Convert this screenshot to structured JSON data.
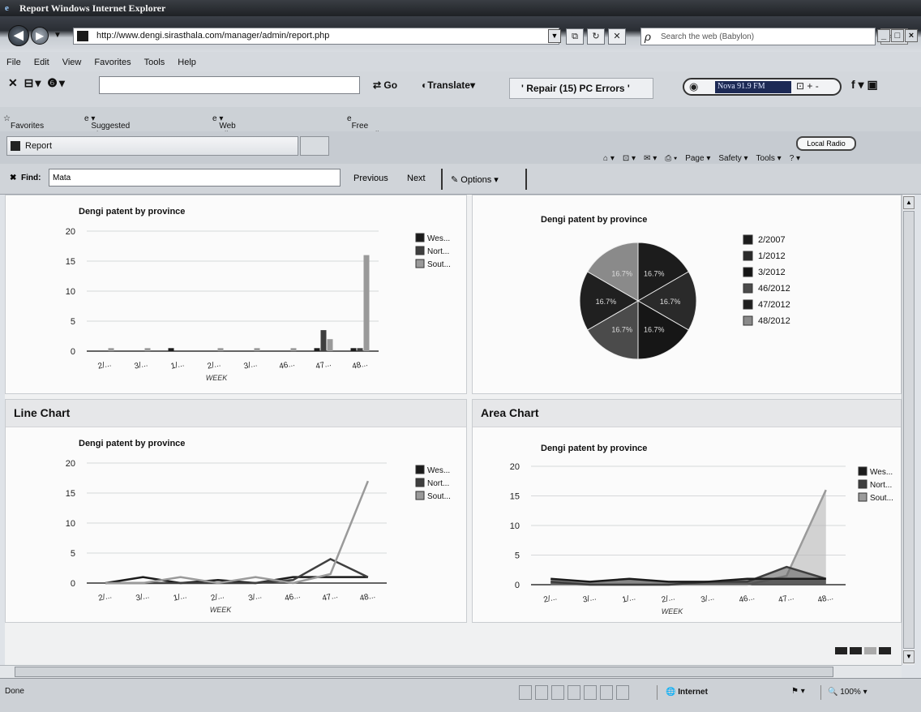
{
  "window": {
    "title": "Report   Windows Internet Explorer",
    "controls": [
      "_",
      "□",
      "×"
    ]
  },
  "address": {
    "url": "http://www.dengi.sirasthala.com/manager/admin/report.php",
    "search_placeholder": "Search the web (Babylon)"
  },
  "menu": [
    "File",
    "Edit",
    "View",
    "Favorites",
    "Tools",
    "Help"
  ],
  "toolbar": {
    "go": "Go",
    "translate": "Translate",
    "repair": "' Repair (15) PC Errors '",
    "radio_station": "Nova 91.9 FM",
    "local_radio": "Local Radio"
  },
  "favorites": {
    "label": "Favorites",
    "items": [
      "Suggested Sites",
      "Web Slice Gallery",
      "Free Hotmail"
    ]
  },
  "tab": {
    "label": "Report"
  },
  "commandbar": [
    "Page",
    "Safety",
    "Tools"
  ],
  "find": {
    "label": "Find:",
    "value": "Mata",
    "previous": "Previous",
    "next": "Next",
    "options": "Options"
  },
  "panels": {
    "line_header": "Line Chart",
    "area_header": "Area Chart"
  },
  "status": {
    "text": "Done",
    "zone": "Internet",
    "zoom": "100%"
  },
  "colors": {
    "west": "#1b1b1b",
    "north": "#3f3f3f",
    "south": "#9a9a9a"
  },
  "chart_data": [
    {
      "type": "bar",
      "title": "Dengi patent by province",
      "xlabel": "WEEK",
      "categories": [
        "2/...",
        "3/...",
        "1/...",
        "2/...",
        "3/...",
        "46...",
        "47...",
        "48..."
      ],
      "series": [
        {
          "name": "Wes...",
          "values": [
            0,
            0,
            0.5,
            0,
            0,
            0,
            0.5,
            0.5
          ]
        },
        {
          "name": "Nort...",
          "values": [
            0,
            0,
            0,
            0,
            0,
            0,
            3.5,
            0.5
          ]
        },
        {
          "name": "Sout...",
          "values": [
            0.5,
            0.5,
            0,
            0.5,
            0.5,
            0.5,
            2,
            16
          ]
        }
      ],
      "ylim": [
        0,
        20
      ],
      "yticks": [
        0,
        5,
        10,
        15,
        20
      ],
      "legend": "right",
      "grid": true
    },
    {
      "type": "pie",
      "title": "Dengi patent by province",
      "labels": [
        "2/2007",
        "1/2012",
        "3/2012",
        "46/2012",
        "47/2012",
        "48/2012"
      ],
      "values": [
        16.7,
        16.7,
        16.7,
        16.7,
        16.7,
        16.7
      ],
      "slice_labels": [
        "16.7%",
        "16.7%",
        "16.7%",
        "16.7%",
        "16.7%",
        "16.7%"
      ],
      "legend": "right"
    },
    {
      "type": "line",
      "title": "Dengi patent by province",
      "xlabel": "WEEK",
      "categories": [
        "2/...",
        "3/...",
        "1/...",
        "2/...",
        "3/...",
        "46...",
        "47...",
        "48..."
      ],
      "series": [
        {
          "name": "Wes...",
          "values": [
            0,
            1,
            0,
            0.5,
            0,
            1,
            1,
            1
          ]
        },
        {
          "name": "Nort...",
          "values": [
            0,
            0,
            0,
            0,
            0,
            0.5,
            4,
            1
          ]
        },
        {
          "name": "Sout...",
          "values": [
            0,
            0,
            1,
            0,
            1,
            0,
            1.5,
            17
          ]
        }
      ],
      "ylim": [
        0,
        20
      ],
      "yticks": [
        0,
        5,
        10,
        15,
        20
      ],
      "legend": "right",
      "grid": true
    },
    {
      "type": "area",
      "title": "Dengi patent by province",
      "xlabel": "WEEK",
      "categories": [
        "2/...",
        "3/...",
        "1/...",
        "2/...",
        "3/...",
        "46...",
        "47...",
        "48..."
      ],
      "series": [
        {
          "name": "Wes...",
          "values": [
            1,
            0.5,
            1,
            0.5,
            0.5,
            1,
            1,
            1
          ]
        },
        {
          "name": "Nort...",
          "values": [
            0.5,
            0,
            0,
            0,
            0.5,
            0.5,
            3,
            1
          ]
        },
        {
          "name": "Sout...",
          "values": [
            0,
            0,
            0,
            0,
            0,
            0,
            1.5,
            16
          ]
        }
      ],
      "ylim": [
        0,
        20
      ],
      "yticks": [
        0,
        5,
        10,
        15,
        20
      ],
      "legend": "right",
      "grid": true
    }
  ]
}
